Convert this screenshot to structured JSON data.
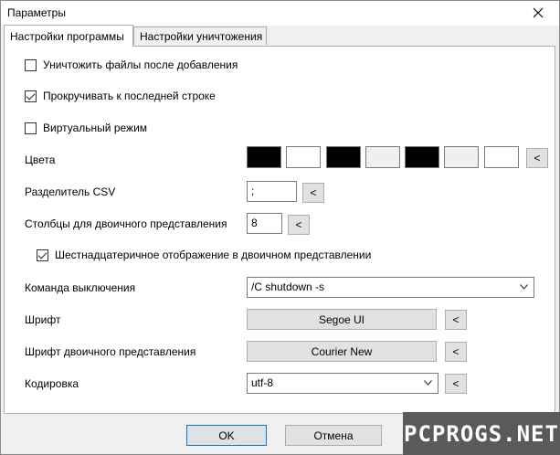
{
  "window": {
    "title": "Параметры"
  },
  "tabs": [
    {
      "label": "Настройки программы",
      "active": true
    },
    {
      "label": "Настройки уничтожения",
      "active": false
    }
  ],
  "options": {
    "destroy_after_add": {
      "label": "Уничтожить файлы после добавления",
      "checked": false
    },
    "scroll_last_line": {
      "label": "Прокручивать к последней строке",
      "checked": true
    },
    "virtual_mode": {
      "label": "Виртуальный режим",
      "checked": false
    }
  },
  "colors": {
    "label": "Цвета",
    "swatches": [
      "#000000",
      "#ffffff",
      "#000000",
      "#efefef",
      "#000000",
      "#efefef",
      "#ffffff"
    ],
    "button_label": "<"
  },
  "csv": {
    "label": "Разделитель CSV",
    "value": ";",
    "button_label": "<"
  },
  "binary_columns": {
    "label": "Столбцы для двоичного представления",
    "value": "8",
    "button_label": "<"
  },
  "hex_display": {
    "label": "Шестнадцатеричное отображение в двоичном представлении",
    "checked": true
  },
  "shutdown": {
    "label": "Команда выключения",
    "value": "/C shutdown -s"
  },
  "font": {
    "label": "Шрифт",
    "value": "Segoe UI",
    "button_label": "<"
  },
  "binary_font": {
    "label": "Шрифт двоичного представления",
    "value": "Courier New",
    "button_label": "<"
  },
  "encoding": {
    "label": "Кодировка",
    "value": "utf-8",
    "button_label": "<"
  },
  "buttons": {
    "ok": "OK",
    "cancel": "Отмена"
  },
  "watermark": "PCPROGS.NET"
}
